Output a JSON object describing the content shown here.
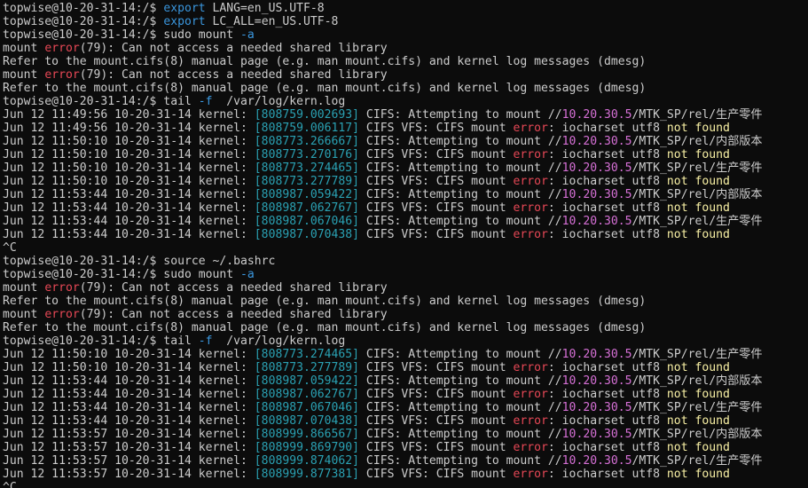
{
  "window": {
    "title": ""
  },
  "colors": {
    "background": "#0c0c0c",
    "default": "#cccccc",
    "cyan": "#3a96dd",
    "tscyan": "#2aa1b3",
    "red": "#e74856",
    "magenta": "#d670d6",
    "yellow": "#f9f1a5"
  },
  "lines": [
    {
      "type": "prompt",
      "segs": [
        {
          "t": "topwise@10-20-31-14:/$ ",
          "c": "default"
        },
        {
          "t": "export",
          "c": "cyan"
        },
        {
          "t": " LANG=en_US.UTF-8",
          "c": "default"
        }
      ]
    },
    {
      "type": "prompt",
      "segs": [
        {
          "t": "topwise@10-20-31-14:/$ ",
          "c": "default"
        },
        {
          "t": "export",
          "c": "cyan"
        },
        {
          "t": " LC_ALL=en_US.UTF-8",
          "c": "default"
        }
      ]
    },
    {
      "type": "prompt",
      "segs": [
        {
          "t": "topwise@10-20-31-14:/$ sudo mount ",
          "c": "default"
        },
        {
          "t": "-a",
          "c": "cyan"
        }
      ]
    },
    {
      "type": "output",
      "segs": [
        {
          "t": "mount ",
          "c": "default"
        },
        {
          "t": "error",
          "c": "red"
        },
        {
          "t": "(79): Can not access a needed shared library",
          "c": "default"
        }
      ]
    },
    {
      "type": "output",
      "segs": [
        {
          "t": "Refer to the mount.cifs(8) manual page (e.g. man mount.cifs) and kernel log messages (dmesg)",
          "c": "default"
        }
      ]
    },
    {
      "type": "output",
      "segs": [
        {
          "t": "mount ",
          "c": "default"
        },
        {
          "t": "error",
          "c": "red"
        },
        {
          "t": "(79): Can not access a needed shared library",
          "c": "default"
        }
      ]
    },
    {
      "type": "output",
      "segs": [
        {
          "t": "Refer to the mount.cifs(8) manual page (e.g. man mount.cifs) and kernel log messages (dmesg)",
          "c": "default"
        }
      ]
    },
    {
      "type": "prompt",
      "segs": [
        {
          "t": "topwise@10-20-31-14:/$ tail ",
          "c": "default"
        },
        {
          "t": "-f",
          "c": "cyan"
        },
        {
          "t": "  /var/log/kern.log",
          "c": "default"
        }
      ]
    },
    {
      "type": "log",
      "segs": [
        {
          "t": "Jun 12 11:49:56 10-20-31-14 kernel: ",
          "c": "default"
        },
        {
          "t": "[808759.002693]",
          "c": "tscyan"
        },
        {
          "t": " CIFS: Attempting to mount //",
          "c": "default"
        },
        {
          "t": "10.20.30.5",
          "c": "magenta"
        },
        {
          "t": "/MTK_SP/rel/生产零件",
          "c": "default"
        }
      ]
    },
    {
      "type": "log",
      "segs": [
        {
          "t": "Jun 12 11:49:56 10-20-31-14 kernel: ",
          "c": "default"
        },
        {
          "t": "[808759.006117]",
          "c": "tscyan"
        },
        {
          "t": " CIFS VFS: CIFS mount ",
          "c": "default"
        },
        {
          "t": "error",
          "c": "red"
        },
        {
          "t": ": iocharset utf8 ",
          "c": "default"
        },
        {
          "t": "not found",
          "c": "yellow"
        }
      ]
    },
    {
      "type": "log",
      "segs": [
        {
          "t": "Jun 12 11:50:10 10-20-31-14 kernel: ",
          "c": "default"
        },
        {
          "t": "[808773.266667]",
          "c": "tscyan"
        },
        {
          "t": " CIFS: Attempting to mount //",
          "c": "default"
        },
        {
          "t": "10.20.30.5",
          "c": "magenta"
        },
        {
          "t": "/MTK_SP/rel/内部版本",
          "c": "default"
        }
      ]
    },
    {
      "type": "log",
      "segs": [
        {
          "t": "Jun 12 11:50:10 10-20-31-14 kernel: ",
          "c": "default"
        },
        {
          "t": "[808773.270176]",
          "c": "tscyan"
        },
        {
          "t": " CIFS VFS: CIFS mount ",
          "c": "default"
        },
        {
          "t": "error",
          "c": "red"
        },
        {
          "t": ": iocharset utf8 ",
          "c": "default"
        },
        {
          "t": "not found",
          "c": "yellow"
        }
      ]
    },
    {
      "type": "log",
      "segs": [
        {
          "t": "Jun 12 11:50:10 10-20-31-14 kernel: ",
          "c": "default"
        },
        {
          "t": "[808773.274465]",
          "c": "tscyan"
        },
        {
          "t": " CIFS: Attempting to mount //",
          "c": "default"
        },
        {
          "t": "10.20.30.5",
          "c": "magenta"
        },
        {
          "t": "/MTK_SP/rel/生产零件",
          "c": "default"
        }
      ]
    },
    {
      "type": "log",
      "segs": [
        {
          "t": "Jun 12 11:50:10 10-20-31-14 kernel: ",
          "c": "default"
        },
        {
          "t": "[808773.277789]",
          "c": "tscyan"
        },
        {
          "t": " CIFS VFS: CIFS mount ",
          "c": "default"
        },
        {
          "t": "error",
          "c": "red"
        },
        {
          "t": ": iocharset utf8 ",
          "c": "default"
        },
        {
          "t": "not found",
          "c": "yellow"
        }
      ]
    },
    {
      "type": "log",
      "segs": [
        {
          "t": "Jun 12 11:53:44 10-20-31-14 kernel: ",
          "c": "default"
        },
        {
          "t": "[808987.059422]",
          "c": "tscyan"
        },
        {
          "t": " CIFS: Attempting to mount //",
          "c": "default"
        },
        {
          "t": "10.20.30.5",
          "c": "magenta"
        },
        {
          "t": "/MTK_SP/rel/内部版本",
          "c": "default"
        }
      ]
    },
    {
      "type": "log",
      "segs": [
        {
          "t": "Jun 12 11:53:44 10-20-31-14 kernel: ",
          "c": "default"
        },
        {
          "t": "[808987.062767]",
          "c": "tscyan"
        },
        {
          "t": " CIFS VFS: CIFS mount ",
          "c": "default"
        },
        {
          "t": "error",
          "c": "red"
        },
        {
          "t": ": iocharset utf8 ",
          "c": "default"
        },
        {
          "t": "not found",
          "c": "yellow"
        }
      ]
    },
    {
      "type": "log",
      "segs": [
        {
          "t": "Jun 12 11:53:44 10-20-31-14 kernel: ",
          "c": "default"
        },
        {
          "t": "[808987.067046]",
          "c": "tscyan"
        },
        {
          "t": " CIFS: Attempting to mount //",
          "c": "default"
        },
        {
          "t": "10.20.30.5",
          "c": "magenta"
        },
        {
          "t": "/MTK_SP/rel/生产零件",
          "c": "default"
        }
      ]
    },
    {
      "type": "log",
      "segs": [
        {
          "t": "Jun 12 11:53:44 10-20-31-14 kernel: ",
          "c": "default"
        },
        {
          "t": "[808987.070438]",
          "c": "tscyan"
        },
        {
          "t": " CIFS VFS: CIFS mount ",
          "c": "default"
        },
        {
          "t": "error",
          "c": "red"
        },
        {
          "t": ": iocharset utf8 ",
          "c": "default"
        },
        {
          "t": "not found",
          "c": "yellow"
        }
      ]
    },
    {
      "type": "output",
      "segs": [
        {
          "t": "^C",
          "c": "default"
        }
      ]
    },
    {
      "type": "prompt",
      "segs": [
        {
          "t": "topwise@10-20-31-14:/$ source ~/.bashrc",
          "c": "default"
        }
      ]
    },
    {
      "type": "prompt",
      "segs": [
        {
          "t": "topwise@10-20-31-14:/$ sudo mount ",
          "c": "default"
        },
        {
          "t": "-a",
          "c": "cyan"
        }
      ]
    },
    {
      "type": "output",
      "segs": [
        {
          "t": "mount ",
          "c": "default"
        },
        {
          "t": "error",
          "c": "red"
        },
        {
          "t": "(79): Can not access a needed shared library",
          "c": "default"
        }
      ]
    },
    {
      "type": "output",
      "segs": [
        {
          "t": "Refer to the mount.cifs(8) manual page (e.g. man mount.cifs) and kernel log messages (dmesg)",
          "c": "default"
        }
      ]
    },
    {
      "type": "output",
      "segs": [
        {
          "t": "mount ",
          "c": "default"
        },
        {
          "t": "error",
          "c": "red"
        },
        {
          "t": "(79): Can not access a needed shared library",
          "c": "default"
        }
      ]
    },
    {
      "type": "output",
      "segs": [
        {
          "t": "Refer to the mount.cifs(8) manual page (e.g. man mount.cifs) and kernel log messages (dmesg)",
          "c": "default"
        }
      ]
    },
    {
      "type": "prompt",
      "segs": [
        {
          "t": "topwise@10-20-31-14:/$ tail ",
          "c": "default"
        },
        {
          "t": "-f",
          "c": "cyan"
        },
        {
          "t": "  /var/log/kern.log",
          "c": "default"
        }
      ]
    },
    {
      "type": "log",
      "segs": [
        {
          "t": "Jun 12 11:50:10 10-20-31-14 kernel: ",
          "c": "default"
        },
        {
          "t": "[808773.274465]",
          "c": "tscyan"
        },
        {
          "t": " CIFS: Attempting to mount //",
          "c": "default"
        },
        {
          "t": "10.20.30.5",
          "c": "magenta"
        },
        {
          "t": "/MTK_SP/rel/生产零件",
          "c": "default"
        }
      ]
    },
    {
      "type": "log",
      "segs": [
        {
          "t": "Jun 12 11:50:10 10-20-31-14 kernel: ",
          "c": "default"
        },
        {
          "t": "[808773.277789]",
          "c": "tscyan"
        },
        {
          "t": " CIFS VFS: CIFS mount ",
          "c": "default"
        },
        {
          "t": "error",
          "c": "red"
        },
        {
          "t": ": iocharset utf8 ",
          "c": "default"
        },
        {
          "t": "not found",
          "c": "yellow"
        }
      ]
    },
    {
      "type": "log",
      "segs": [
        {
          "t": "Jun 12 11:53:44 10-20-31-14 kernel: ",
          "c": "default"
        },
        {
          "t": "[808987.059422]",
          "c": "tscyan"
        },
        {
          "t": " CIFS: Attempting to mount //",
          "c": "default"
        },
        {
          "t": "10.20.30.5",
          "c": "magenta"
        },
        {
          "t": "/MTK_SP/rel/内部版本",
          "c": "default"
        }
      ]
    },
    {
      "type": "log",
      "segs": [
        {
          "t": "Jun 12 11:53:44 10-20-31-14 kernel: ",
          "c": "default"
        },
        {
          "t": "[808987.062767]",
          "c": "tscyan"
        },
        {
          "t": " CIFS VFS: CIFS mount ",
          "c": "default"
        },
        {
          "t": "error",
          "c": "red"
        },
        {
          "t": ": iocharset utf8 ",
          "c": "default"
        },
        {
          "t": "not found",
          "c": "yellow"
        }
      ]
    },
    {
      "type": "log",
      "segs": [
        {
          "t": "Jun 12 11:53:44 10-20-31-14 kernel: ",
          "c": "default"
        },
        {
          "t": "[808987.067046]",
          "c": "tscyan"
        },
        {
          "t": " CIFS: Attempting to mount //",
          "c": "default"
        },
        {
          "t": "10.20.30.5",
          "c": "magenta"
        },
        {
          "t": "/MTK_SP/rel/生产零件",
          "c": "default"
        }
      ]
    },
    {
      "type": "log",
      "segs": [
        {
          "t": "Jun 12 11:53:44 10-20-31-14 kernel: ",
          "c": "default"
        },
        {
          "t": "[808987.070438]",
          "c": "tscyan"
        },
        {
          "t": " CIFS VFS: CIFS mount ",
          "c": "default"
        },
        {
          "t": "error",
          "c": "red"
        },
        {
          "t": ": iocharset utf8 ",
          "c": "default"
        },
        {
          "t": "not found",
          "c": "yellow"
        }
      ]
    },
    {
      "type": "log",
      "segs": [
        {
          "t": "Jun 12 11:53:57 10-20-31-14 kernel: ",
          "c": "default"
        },
        {
          "t": "[808999.866567]",
          "c": "tscyan"
        },
        {
          "t": " CIFS: Attempting to mount //",
          "c": "default"
        },
        {
          "t": "10.20.30.5",
          "c": "magenta"
        },
        {
          "t": "/MTK_SP/rel/内部版本",
          "c": "default"
        }
      ]
    },
    {
      "type": "log",
      "segs": [
        {
          "t": "Jun 12 11:53:57 10-20-31-14 kernel: ",
          "c": "default"
        },
        {
          "t": "[808999.869790]",
          "c": "tscyan"
        },
        {
          "t": " CIFS VFS: CIFS mount ",
          "c": "default"
        },
        {
          "t": "error",
          "c": "red"
        },
        {
          "t": ": iocharset utf8 ",
          "c": "default"
        },
        {
          "t": "not found",
          "c": "yellow"
        }
      ]
    },
    {
      "type": "log",
      "segs": [
        {
          "t": "Jun 12 11:53:57 10-20-31-14 kernel: ",
          "c": "default"
        },
        {
          "t": "[808999.874062]",
          "c": "tscyan"
        },
        {
          "t": " CIFS: Attempting to mount //",
          "c": "default"
        },
        {
          "t": "10.20.30.5",
          "c": "magenta"
        },
        {
          "t": "/MTK_SP/rel/生产零件",
          "c": "default"
        }
      ]
    },
    {
      "type": "log",
      "segs": [
        {
          "t": "Jun 12 11:53:57 10-20-31-14 kernel: ",
          "c": "default"
        },
        {
          "t": "[808999.877381]",
          "c": "tscyan"
        },
        {
          "t": " CIFS VFS: CIFS mount ",
          "c": "default"
        },
        {
          "t": "error",
          "c": "red"
        },
        {
          "t": ": iocharset utf8 ",
          "c": "default"
        },
        {
          "t": "not found",
          "c": "yellow"
        }
      ]
    },
    {
      "type": "output",
      "segs": [
        {
          "t": "^C",
          "c": "default"
        }
      ]
    }
  ]
}
